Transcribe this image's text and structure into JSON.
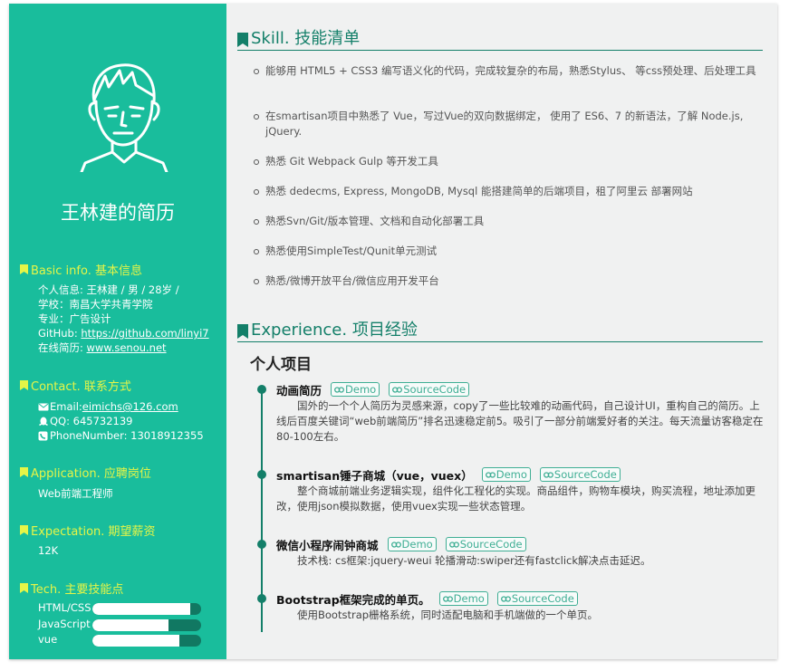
{
  "sidebar": {
    "name": "王林建的简历",
    "basic": {
      "title": "Basic info. 基本信息",
      "lines": [
        "个人信息: 王林建 / 男 / 28岁 /",
        "学校：南昌大学共青学院",
        "专业：广告设计"
      ],
      "github_label": "GitHub: ",
      "github_url": "https://github.com/linyi7",
      "site_label": "在线简历: ",
      "site_url": "www.senou.net"
    },
    "contact": {
      "title": "Contact. 联系方式",
      "email_label": "Email: ",
      "email": "eimichs@126.com",
      "qq": "QQ: 645732139",
      "phone": "PhoneNumber: 13018912355"
    },
    "application": {
      "title": "Application. 应聘岗位",
      "value": "Web前端工程师"
    },
    "expectation": {
      "title": "Expectation. 期望薪资",
      "value": "12K"
    },
    "tech": {
      "title": "Tech. 主要技能点",
      "items": [
        {
          "name": "HTML/CSS",
          "level": 0.9
        },
        {
          "name": "JavaScript",
          "level": 0.7
        },
        {
          "name": "vue",
          "level": 0.8
        }
      ]
    },
    "colors": {
      "sidebar_bg": "#19bd9c",
      "heading_yellow": "#e6f547",
      "accent_dark": "#137f69"
    }
  },
  "main": {
    "skill_title": "Skill. 技能清单",
    "skills": [
      "能够用 HTML5 + CSS3 编写语义化的代码，完成较复杂的布局，熟悉Stylus、 等css预处理、后处理工具",
      "在smartisan项目中熟悉了 Vue，写过Vue的双向数据绑定， 使用了 ES6、7 的新语法，了解 Node.js, jQuery.",
      "熟悉 Git Webpack Gulp 等开发工具",
      "熟悉 dedecms, Express, MongoDB, Mysql 能搭建简单的后端项目，租了阿里云 部署网站",
      "熟悉Svn/Git/版本管理、文档和自动化部署工具",
      "熟悉使用SimpleTest/Qunit单元测试",
      "熟悉/微博开放平台/微信应用开发平台"
    ],
    "experience_title": "Experience. 项目经验",
    "personal_title": "个人项目",
    "demo_label": "Demo",
    "source_label": "SourceCode",
    "projects": [
      {
        "title": "动画简历",
        "desc": "国外的一个个人简历为灵感来源，copy了一些比较难的动画代码，自己设计UI，重构自己的简历。上线后百度关键词“web前端简历”排名迅速稳定前5。吸引了一部分前端爱好者的关注。每天流量访客稳定在80-100左右。"
      },
      {
        "title": "smartisan锤子商城（vue，vuex）",
        "desc": "整个商城前端业务逻辑实现，组件化工程化的实现。商品组件，购物车模块，购买流程，地址添加更改，使用json模拟数据，使用vuex实现一些状态管理。"
      },
      {
        "title": "微信小程序闹钟商城",
        "desc": "技术栈: cs框架:jquery-weui 轮播滑动:swiper还有fastclick解决点击延迟。"
      },
      {
        "title": "Bootstrap框架完成的单页。",
        "desc": "使用Bootstrap栅格系统，同时适配电脑和手机端做的一个单页。"
      }
    ]
  }
}
